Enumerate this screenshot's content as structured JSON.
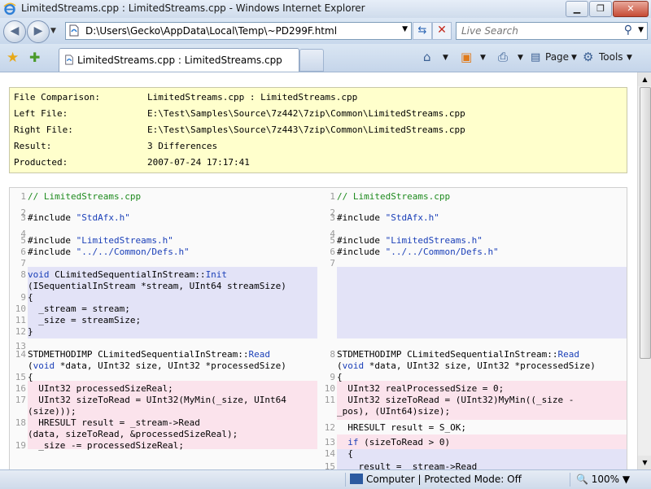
{
  "window": {
    "title": "LimitedStreams.cpp : LimitedStreams.cpp - Windows Internet Explorer",
    "minimize": "▁",
    "maximize": "❐",
    "close": "✕"
  },
  "address_bar": {
    "url": "D:\\Users\\Gecko\\AppData\\Local\\Temp\\~PD299F.html",
    "search_placeholder": "Live Search"
  },
  "tab": {
    "label": "LimitedStreams.cpp : LimitedStreams.cpp"
  },
  "commands": {
    "page": "Page",
    "tools": "Tools"
  },
  "info": {
    "rows": [
      {
        "key": "File Comparison:",
        "value": "LimitedStreams.cpp : LimitedStreams.cpp"
      },
      {
        "key": "Left File:",
        "value": "E:\\Test\\Samples\\Source\\7z442\\7zip\\Common\\LimitedStreams.cpp"
      },
      {
        "key": "Right File:",
        "value": "E:\\Test\\Samples\\Source\\7z443\\7zip\\Common\\LimitedStreams.cpp"
      },
      {
        "key": "Result:",
        "value": "3 Differences"
      },
      {
        "key": "Producted:",
        "value": "2007-07-24 17:17:41"
      }
    ]
  },
  "compare": {
    "left": [
      {
        "n": "1",
        "t": "// LimitedStreams.cpp"
      },
      {
        "n": "2",
        "t": ""
      },
      {
        "n": "3",
        "t": "#include \"StdAfx.h\""
      },
      {
        "n": "4",
        "t": ""
      },
      {
        "n": "5",
        "t": "#include \"LimitedStreams.h\""
      },
      {
        "n": "6",
        "t": "#include \"../../Common/Defs.h\""
      },
      {
        "n": "7",
        "t": ""
      },
      {
        "n": "8",
        "t": "void CLimitedSequentialInStream::Init"
      },
      {
        "n": "",
        "t": "(ISequentialInStream *stream, UInt64 streamSize)"
      },
      {
        "n": "9",
        "t": "{"
      },
      {
        "n": "10",
        "t": "  _stream = stream;"
      },
      {
        "n": "11",
        "t": "  _size = streamSize;"
      },
      {
        "n": "12",
        "t": "}"
      },
      {
        "n": "13",
        "t": ""
      },
      {
        "n": "14",
        "t": "STDMETHODIMP CLimitedSequentialInStream::Read"
      },
      {
        "n": "",
        "t": "(void *data, UInt32 size, UInt32 *processedSize)"
      },
      {
        "n": "15",
        "t": "{"
      },
      {
        "n": "16",
        "t": "  UInt32 processedSizeReal;"
      },
      {
        "n": "17",
        "t": "  UInt32 sizeToRead = UInt32(MyMin(_size, UInt64"
      },
      {
        "n": "",
        "t": "(size)));"
      },
      {
        "n": "18",
        "t": "  HRESULT result = _stream->Read"
      },
      {
        "n": "",
        "t": "(data, sizeToRead, &processedSizeReal);"
      },
      {
        "n": "19",
        "t": "  _size -= processedSizeReal;"
      }
    ],
    "right": [
      {
        "n": "1",
        "t": "// LimitedStreams.cpp"
      },
      {
        "n": "2",
        "t": ""
      },
      {
        "n": "3",
        "t": "#include \"StdAfx.h\""
      },
      {
        "n": "4",
        "t": ""
      },
      {
        "n": "5",
        "t": "#include \"LimitedStreams.h\""
      },
      {
        "n": "6",
        "t": "#include \"../../Common/Defs.h\""
      },
      {
        "n": "7",
        "t": ""
      },
      {
        "n": "8",
        "t": "STDMETHODIMP CLimitedSequentialInStream::Read"
      },
      {
        "n": "",
        "t": "(void *data, UInt32 size, UInt32 *processedSize)"
      },
      {
        "n": "9",
        "t": "{"
      },
      {
        "n": "10",
        "t": "  UInt32 realProcessedSize = 0;"
      },
      {
        "n": "11",
        "t": "  UInt32 sizeToRead = (UInt32)MyMin((_size -"
      },
      {
        "n": "",
        "t": "_pos), (UInt64)size);"
      },
      {
        "n": "12",
        "t": "  HRESULT result = S_OK;"
      },
      {
        "n": "13",
        "t": "  if (sizeToRead > 0)"
      },
      {
        "n": "14",
        "t": "  {"
      },
      {
        "n": "15",
        "t": "    result = _stream->Read"
      }
    ]
  },
  "status": {
    "zone": "Computer | Protected Mode: Off",
    "zoom": "100%"
  },
  "colors": {
    "diff_blue": "#e3e3f7",
    "diff_pink": "#fbe3ec",
    "info_bg": "#ffffcc"
  }
}
